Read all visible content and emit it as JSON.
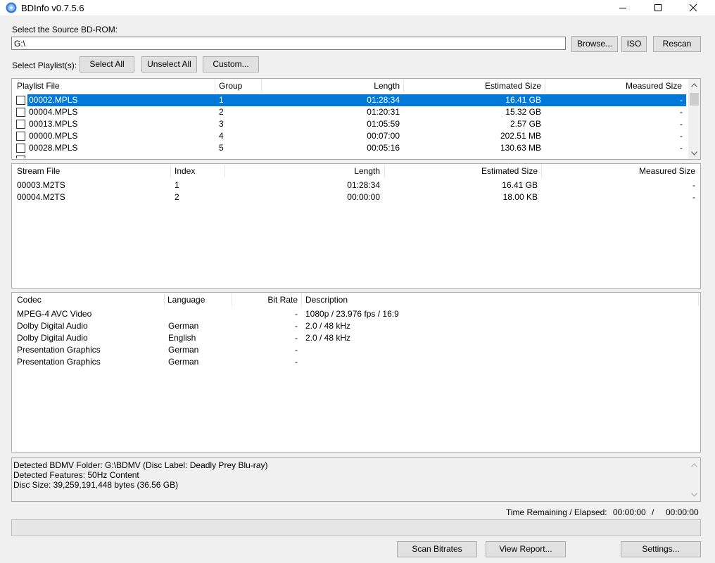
{
  "window": {
    "title": "BDInfo v0.7.5.6",
    "icons": {
      "app": "disc-icon",
      "minimize": "minimize-icon",
      "maximize": "maximize-icon",
      "close": "close-icon"
    }
  },
  "source": {
    "label": "Select the Source BD-ROM:",
    "path": "G:\\",
    "browse": "Browse...",
    "iso": "ISO",
    "rescan": "Rescan"
  },
  "playlist_controls": {
    "label": "Select Playlist(s):",
    "select_all": "Select All",
    "unselect_all": "Unselect All",
    "custom": "Custom..."
  },
  "playlists": {
    "columns": [
      "Playlist File",
      "Group",
      "Length",
      "Estimated Size",
      "Measured Size"
    ],
    "rows": [
      {
        "file": "00002.MPLS",
        "group": "1",
        "length": "01:28:34",
        "est": "16.41 GB",
        "meas": "-"
      },
      {
        "file": "00004.MPLS",
        "group": "2",
        "length": "01:20:31",
        "est": "15.32 GB",
        "meas": "-"
      },
      {
        "file": "00013.MPLS",
        "group": "3",
        "length": "01:05:59",
        "est": "2.57 GB",
        "meas": "-"
      },
      {
        "file": "00000.MPLS",
        "group": "4",
        "length": "00:07:00",
        "est": "202.51 MB",
        "meas": "-"
      },
      {
        "file": "00028.MPLS",
        "group": "5",
        "length": "00:05:16",
        "est": "130.63 MB",
        "meas": "-"
      }
    ],
    "selected_index": 0
  },
  "streams": {
    "columns": [
      "Stream File",
      "Index",
      "Length",
      "Estimated Size",
      "Measured Size"
    ],
    "rows": [
      {
        "file": "00003.M2TS",
        "index": "1",
        "length": "01:28:34",
        "est": "16.41 GB",
        "meas": "-"
      },
      {
        "file": "00004.M2TS",
        "index": "2",
        "length": "00:00:00",
        "est": "18.00 KB",
        "meas": "-"
      }
    ]
  },
  "codecs": {
    "columns": [
      "Codec",
      "Language",
      "Bit Rate",
      "Description"
    ],
    "rows": [
      {
        "codec": "MPEG-4 AVC Video",
        "lang": "",
        "bitrate": "-",
        "desc": "1080p / 23.976 fps / 16:9"
      },
      {
        "codec": "Dolby Digital Audio",
        "lang": "German",
        "bitrate": "-",
        "desc": "2.0 / 48 kHz"
      },
      {
        "codec": "Dolby Digital Audio",
        "lang": "English",
        "bitrate": "-",
        "desc": "2.0 / 48 kHz"
      },
      {
        "codec": "Presentation Graphics",
        "lang": "German",
        "bitrate": "-",
        "desc": ""
      },
      {
        "codec": "Presentation Graphics",
        "lang": "German",
        "bitrate": "-",
        "desc": ""
      }
    ]
  },
  "info_lines": [
    "Detected BDMV Folder: G:\\BDMV (Disc Label: Deadly Prey Blu-ray)",
    "Detected Features: 50Hz Content",
    "Disc Size: 39,259,191,448 bytes (36.56 GB)"
  ],
  "status": {
    "time_label": "Time Remaining / Elapsed:",
    "remaining": "00:00:00",
    "separator": "/",
    "elapsed": "00:00:00",
    "progress": 0
  },
  "bottom_buttons": {
    "scan": "Scan Bitrates",
    "report": "View Report...",
    "settings": "Settings..."
  }
}
